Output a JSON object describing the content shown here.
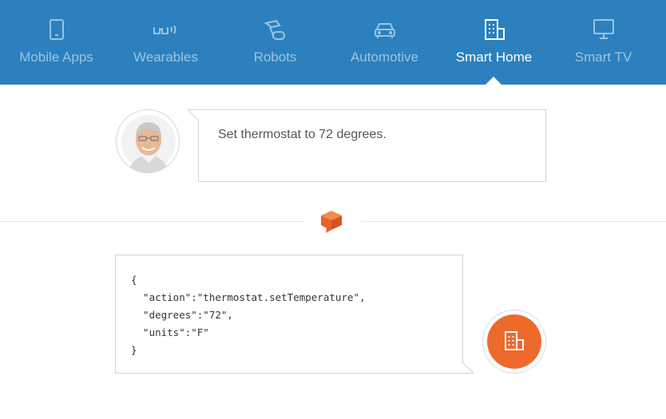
{
  "tabs": [
    {
      "label": "Mobile Apps",
      "icon": "mobile-phone-icon",
      "active": false
    },
    {
      "label": "Wearables",
      "icon": "glasses-icon",
      "active": false
    },
    {
      "label": "Robots",
      "icon": "robot-arm-icon",
      "active": false
    },
    {
      "label": "Automotive",
      "icon": "car-icon",
      "active": false
    },
    {
      "label": "Smart Home",
      "icon": "building-icon",
      "active": true
    },
    {
      "label": "Smart TV",
      "icon": "monitor-icon",
      "active": false
    }
  ],
  "user_message": {
    "text": "Set thermostat to 72 degrees.",
    "avatar": "user-avatar"
  },
  "response": {
    "lines": [
      "{",
      "  \"action\":\"thermostat.setTemperature\",",
      "  \"degrees\":\"72\",",
      "  \"units\":\"F\"",
      "}"
    ],
    "device_icon": "building-icon"
  },
  "colors": {
    "nav_bg": "#2b80bd",
    "nav_inactive": "#9cc4e2",
    "nav_active": "#ffffff",
    "accent": "#ee6a2c"
  }
}
